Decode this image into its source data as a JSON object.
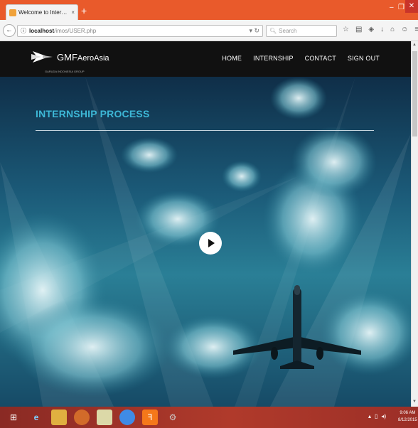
{
  "browser": {
    "tab_title": "Welcome to Internship Ma...",
    "tab_close": "×",
    "new_tab": "+",
    "url_host": "localhost",
    "url_path": "/imos/USER.php",
    "search_placeholder": "Search",
    "accent_color": "#e95a2b"
  },
  "site": {
    "logo_text": "GMF",
    "logo_text_suffix": "AeroAsia",
    "logo_tagline": "GARUDA INDONESIA GROUP",
    "menu": [
      "HOME",
      "INTERNSHIP",
      "CONTACT",
      "SIGN OUT"
    ]
  },
  "hero": {
    "title": "INTERNSHIP PROCESS",
    "title_color": "#3db7d6",
    "scroll_top_icon": "chevron-up-icon"
  },
  "taskbar": {
    "time": "9:06 AM",
    "date": "8/12/2015",
    "apps": [
      "windows-start-icon",
      "ie-icon",
      "explorer-icon",
      "firefox-icon",
      "notepad-icon",
      "chrome-icon",
      "xampp-icon",
      "settings-icon"
    ]
  }
}
